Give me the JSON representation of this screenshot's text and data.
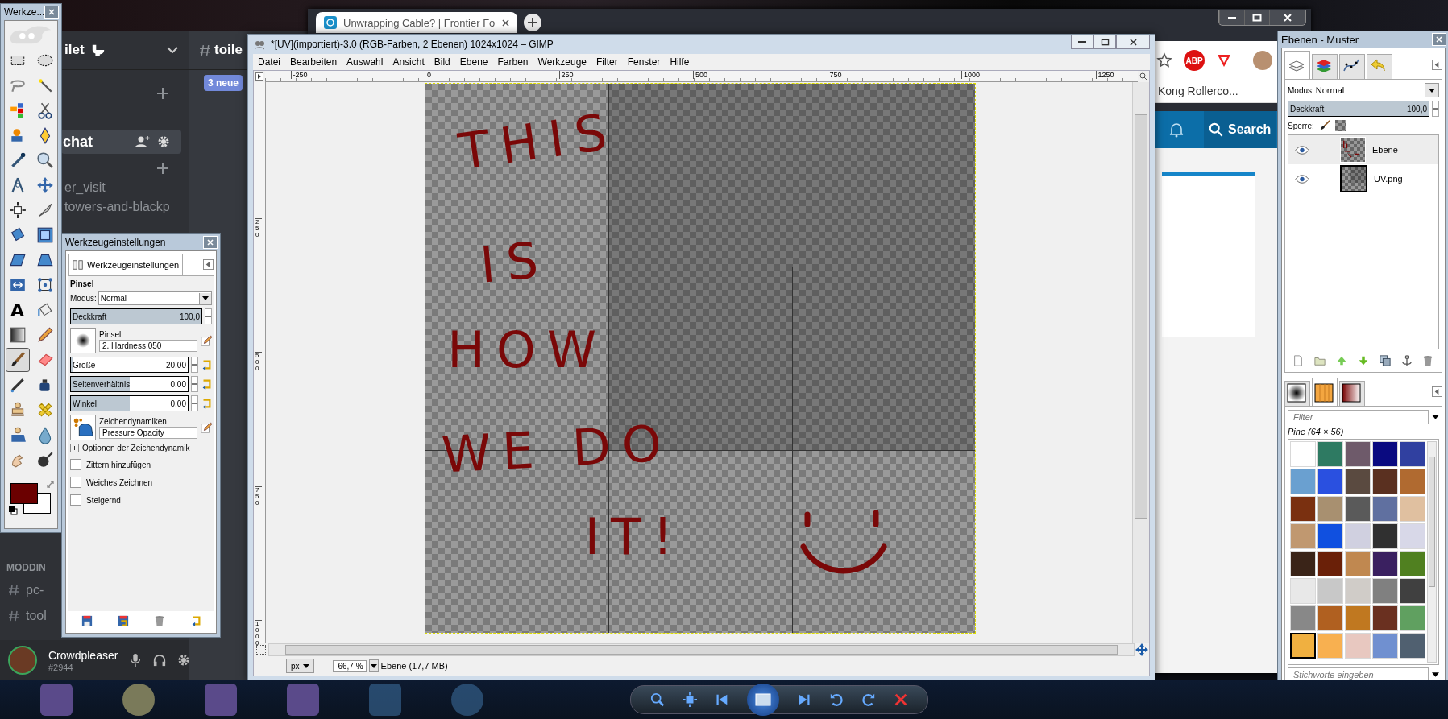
{
  "discord": {
    "server_name": "ilet",
    "channel_header": "toile",
    "new_messages_badge": "3 neue",
    "active_channel": "chat",
    "channels": [
      "er_visit",
      "towers-and-blackp"
    ],
    "category": "MODDIN",
    "category_channels": [
      "pc-",
      "tool"
    ],
    "user": {
      "name": "Crowdpleaser",
      "tag": "#2944"
    }
  },
  "browser": {
    "tab_title": "Unwrapping Cable? | Frontier Fo",
    "adblock_badge": "ABP",
    "bookmark": "Kong Rollerco...",
    "search_button": "Search"
  },
  "toolbox": {
    "title": "Werkze...",
    "colors": [
      {
        "kind": "foreground",
        "color": "#6b0000"
      },
      {
        "kind": "background",
        "color": "#ffffff"
      }
    ],
    "tools": [
      {
        "kind": "rect-select",
        "selected": false
      },
      {
        "kind": "ellipse-select",
        "selected": false
      },
      {
        "kind": "free-select",
        "selected": false
      },
      {
        "kind": "fuzzy-select",
        "selected": false
      },
      {
        "kind": "color-select",
        "selected": false
      },
      {
        "kind": "scissors",
        "selected": false
      },
      {
        "kind": "foreground-select",
        "selected": false
      },
      {
        "kind": "paths",
        "selected": false
      },
      {
        "kind": "color-picker",
        "selected": false
      },
      {
        "kind": "zoom",
        "selected": false
      },
      {
        "kind": "measure",
        "selected": false
      },
      {
        "kind": "move",
        "selected": false
      },
      {
        "kind": "align",
        "selected": false
      },
      {
        "kind": "crop",
        "selected": false
      },
      {
        "kind": "rotate",
        "selected": false
      },
      {
        "kind": "scale",
        "selected": false
      },
      {
        "kind": "shear",
        "selected": false
      },
      {
        "kind": "perspective",
        "selected": false
      },
      {
        "kind": "flip",
        "selected": false
      },
      {
        "kind": "cage",
        "selected": false
      },
      {
        "kind": "text",
        "glyph": "A",
        "selected": false
      },
      {
        "kind": "bucket-fill",
        "selected": false
      },
      {
        "kind": "blend",
        "selected": false
      },
      {
        "kind": "pencil",
        "selected": false
      },
      {
        "kind": "paintbrush",
        "selected": true
      },
      {
        "kind": "eraser",
        "selected": false
      },
      {
        "kind": "airbrush",
        "selected": false
      },
      {
        "kind": "ink",
        "selected": false
      },
      {
        "kind": "clone",
        "selected": false
      },
      {
        "kind": "heal",
        "selected": false
      },
      {
        "kind": "perspective-clone",
        "selected": false
      },
      {
        "kind": "blur",
        "selected": false
      },
      {
        "kind": "smudge",
        "selected": false
      },
      {
        "kind": "dodge",
        "selected": false
      }
    ]
  },
  "tool_options": {
    "title": "Werkzeugeinstellungen",
    "tab": "Werkzeugeinstellungen",
    "tool_name": "Pinsel",
    "mode_label": "Modus:",
    "mode": "Normal",
    "opacity": {
      "label": "Deckkraft",
      "value": "100,0",
      "level": 1
    },
    "brush_label": "Pinsel",
    "brush": "2. Hardness 050",
    "sliders": [
      {
        "label": "Größe",
        "value": "20,00",
        "level": 0.02
      },
      {
        "label": "Seitenverhältnis",
        "value": "0,00",
        "level": 0.5
      },
      {
        "label": "Winkel",
        "value": "0,00",
        "level": 0.5
      }
    ],
    "dynamics_label": "Zeichendynamiken",
    "dynamics": "Pressure Opacity",
    "dynamics_options": {
      "label": "Optionen der Zeichendynamik",
      "expanded": false
    },
    "checkboxes": [
      {
        "label": "Zittern hinzufügen",
        "checked": false
      },
      {
        "label": "Weiches Zeichnen",
        "checked": false
      },
      {
        "label": "Steigernd",
        "checked": false
      }
    ]
  },
  "image_window": {
    "title": "*[UV](importiert)-3.0 (RGB-Farben, 2 Ebenen) 1024x1024 – GIMP",
    "menu": [
      "Datei",
      "Bearbeiten",
      "Auswahl",
      "Ansicht",
      "Bild",
      "Ebene",
      "Farben",
      "Werkzeuge",
      "Filter",
      "Fenster",
      "Hilfe"
    ],
    "ruler_h": [
      "-250",
      "0",
      "250",
      "500",
      "750",
      "1000",
      "1250"
    ],
    "ruler_v": [
      "250",
      "500",
      "750",
      "1000"
    ],
    "painting": [
      "THIS",
      "IS",
      "HOW",
      "WE DO",
      "IT!"
    ],
    "unit": "px",
    "zoom": "66,7 %",
    "status": "Ebene (17,7 MB)"
  },
  "layers_dock": {
    "title": "Ebenen - Muster",
    "tabs": [
      {
        "kind": "layers",
        "selected": true
      },
      {
        "kind": "channels",
        "selected": false
      },
      {
        "kind": "paths",
        "selected": false
      },
      {
        "kind": "undo",
        "selected": false
      }
    ],
    "mode_label": "Modus:",
    "mode": "Normal",
    "opacity": {
      "label": "Deckkraft",
      "value": "100,0",
      "level": 1
    },
    "lock_label": "Sperre:",
    "layers": [
      {
        "name": "Ebene",
        "kind": "painted",
        "visible": true,
        "selected": true
      },
      {
        "name": "UV.png",
        "kind": "image",
        "visible": true,
        "selected": false
      }
    ]
  },
  "patterns_dock": {
    "tabs": [
      {
        "kind": "brushes",
        "selected": false
      },
      {
        "kind": "patterns",
        "selected": true
      },
      {
        "kind": "gradients",
        "selected": false
      }
    ],
    "filter_placeholder": "Filter",
    "current": "Pine (64 × 56)",
    "tag_placeholder": "Stichworte eingeben",
    "patterns": [
      {
        "color": "#ffffff",
        "selected": false
      },
      {
        "color": "#2e7a62",
        "selected": false
      },
      {
        "color": "#6e5a6a",
        "selected": false
      },
      {
        "color": "#0a0a80",
        "selected": false
      },
      {
        "color": "#3040a0",
        "selected": false
      },
      {
        "color": "#6aa0d0",
        "selected": false
      },
      {
        "color": "#2a50e0",
        "selected": false
      },
      {
        "color": "#5a4a40",
        "selected": false
      },
      {
        "color": "#5a3020",
        "selected": false
      },
      {
        "color": "#b06a30",
        "selected": false
      },
      {
        "color": "#7a3010",
        "selected": false
      },
      {
        "color": "#a89070",
        "selected": false
      },
      {
        "color": "#5a5a5a",
        "selected": false
      },
      {
        "color": "#6070a0",
        "selected": false
      },
      {
        "color": "#e0c0a0",
        "selected": false
      },
      {
        "color": "#c09870",
        "selected": false
      },
      {
        "color": "#1050e0",
        "selected": false
      },
      {
        "color": "#d0d0e0",
        "selected": false
      },
      {
        "color": "#303030",
        "selected": false
      },
      {
        "color": "#d8d8e8",
        "selected": false
      },
      {
        "color": "#3a2418",
        "selected": false
      },
      {
        "color": "#6a2008",
        "selected": false
      },
      {
        "color": "#c08850",
        "selected": false
      },
      {
        "color": "#3a2060",
        "selected": false
      },
      {
        "color": "#508020",
        "selected": false
      },
      {
        "color": "#e8e8e8",
        "selected": false
      },
      {
        "color": "#c8c8c8",
        "selected": false
      },
      {
        "color": "#d0ccc8",
        "selected": false
      },
      {
        "color": "#808080",
        "selected": false
      },
      {
        "color": "#404040",
        "selected": false
      },
      {
        "color": "#888888",
        "selected": false
      },
      {
        "color": "#b06020",
        "selected": false
      },
      {
        "color": "#c07820",
        "selected": false
      },
      {
        "color": "#6a3020",
        "selected": false
      },
      {
        "color": "#60a060",
        "selected": false
      },
      {
        "color": "#f0b040",
        "selected": true
      },
      {
        "color": "#f8b050",
        "selected": false
      },
      {
        "color": "#e8c8c0",
        "selected": false
      },
      {
        "color": "#7090d0",
        "selected": false
      },
      {
        "color": "#506070",
        "selected": false
      }
    ]
  }
}
